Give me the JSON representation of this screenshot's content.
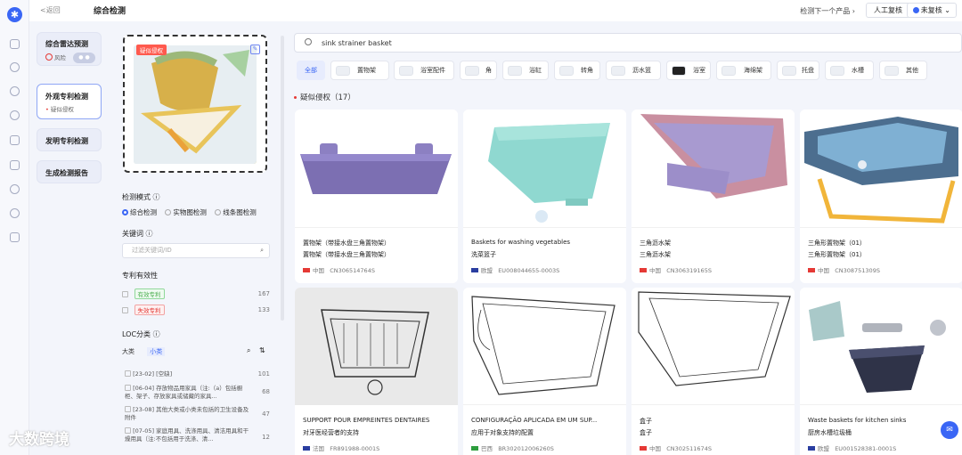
{
  "topbar": {
    "back": "<返回",
    "title": "综合检测",
    "next": "检测下一个产品 ›",
    "manual_review": "人工复核",
    "not_reviewed": "未复核 ⌄"
  },
  "nav": {
    "radar": {
      "label": "综合雷达预测",
      "sub": "风险"
    },
    "appearance": {
      "label": "外观专利检测",
      "sub": "疑似侵权"
    },
    "invention": {
      "label": "发明专利检测"
    },
    "report": {
      "label": "生成检测报告"
    }
  },
  "filter": {
    "badge": "疑似侵权",
    "mode_label": "检测模式 ⓘ",
    "modes": [
      "综合检测",
      "实物图检测",
      "线条图检测"
    ],
    "keyword_label": "关键词 ⓘ",
    "keyword_placeholder": "过滤关键词/ID",
    "validity_label": "专利有效性",
    "validity": [
      {
        "label": "有效专利",
        "count": "167"
      },
      {
        "label": "失效专利",
        "count": "133"
      }
    ],
    "loc_label": "LOC分类 ⓘ",
    "loc_tabs": [
      "大类",
      "小类"
    ],
    "loc_items": [
      {
        "label": "[23-02]  [空缺]",
        "count": "101"
      },
      {
        "label": "[06-04] 存放物品用家具（注:（a）包括橱柜、架子、存放家具或储藏的家具...",
        "count": "68"
      },
      {
        "label": "[23-08] 其他大类或小类未包括的卫生设备及附件",
        "count": "47"
      },
      {
        "label": "[07-05] 家庭用具、洗涤用具、清洁用具和干燥用具（注:不包括用于洗涤、清...",
        "count": "12"
      }
    ]
  },
  "search": {
    "value": "sink strainer basket"
  },
  "chips": [
    "全部",
    "置物架",
    "浴室配件",
    "角",
    "浴缸",
    "转角",
    "沥水篮",
    "浴室",
    "海绵架",
    "托盘",
    "水槽",
    "其他"
  ],
  "results": {
    "title": "疑似侵权（17）",
    "items": [
      {
        "t1": "置物架（带接水盘三角置物架）",
        "t2": "置物架（带接水盘三角置物架）",
        "country": "中国",
        "id": "CN306514764S",
        "flag": "#e53935"
      },
      {
        "t1": "Baskets for washing vegetables",
        "t2": "洗菜篮子",
        "country": "欧盟",
        "id": "EU008044655-0003S",
        "flag": "#2a3ea0"
      },
      {
        "t1": "三角沥水架",
        "t2": "三角沥水架",
        "country": "中国",
        "id": "CN306319165S",
        "flag": "#e53935"
      },
      {
        "t1": "三角形置物架（01）",
        "t2": "三角形置物架（01）",
        "country": "中国",
        "id": "CN308751309S",
        "flag": "#e53935"
      },
      {
        "t1": "SUPPORT POUR EMPREINTES DENTAIRES",
        "t2": "对牙医经营者的支持",
        "country": "法国",
        "id": "FR891988-0001S",
        "flag": "#2a3ea0"
      },
      {
        "t1": "CONFIGURAÇÃO APLICADA EM UM SUP...",
        "t2": "应用于对象支持的配置",
        "country": "巴西",
        "id": "BR302012006260S",
        "flag": "#2e9e3e"
      },
      {
        "t1": "盒子",
        "t2": "盒子",
        "country": "中国",
        "id": "CN302511674S",
        "flag": "#e53935"
      },
      {
        "t1": "Waste baskets for kitchen sinks",
        "t2": "厨房水槽垃圾桶",
        "country": "欧盟",
        "id": "EU001528381-0001S",
        "flag": "#2a3ea0"
      }
    ]
  },
  "watermark": "大数跨境"
}
